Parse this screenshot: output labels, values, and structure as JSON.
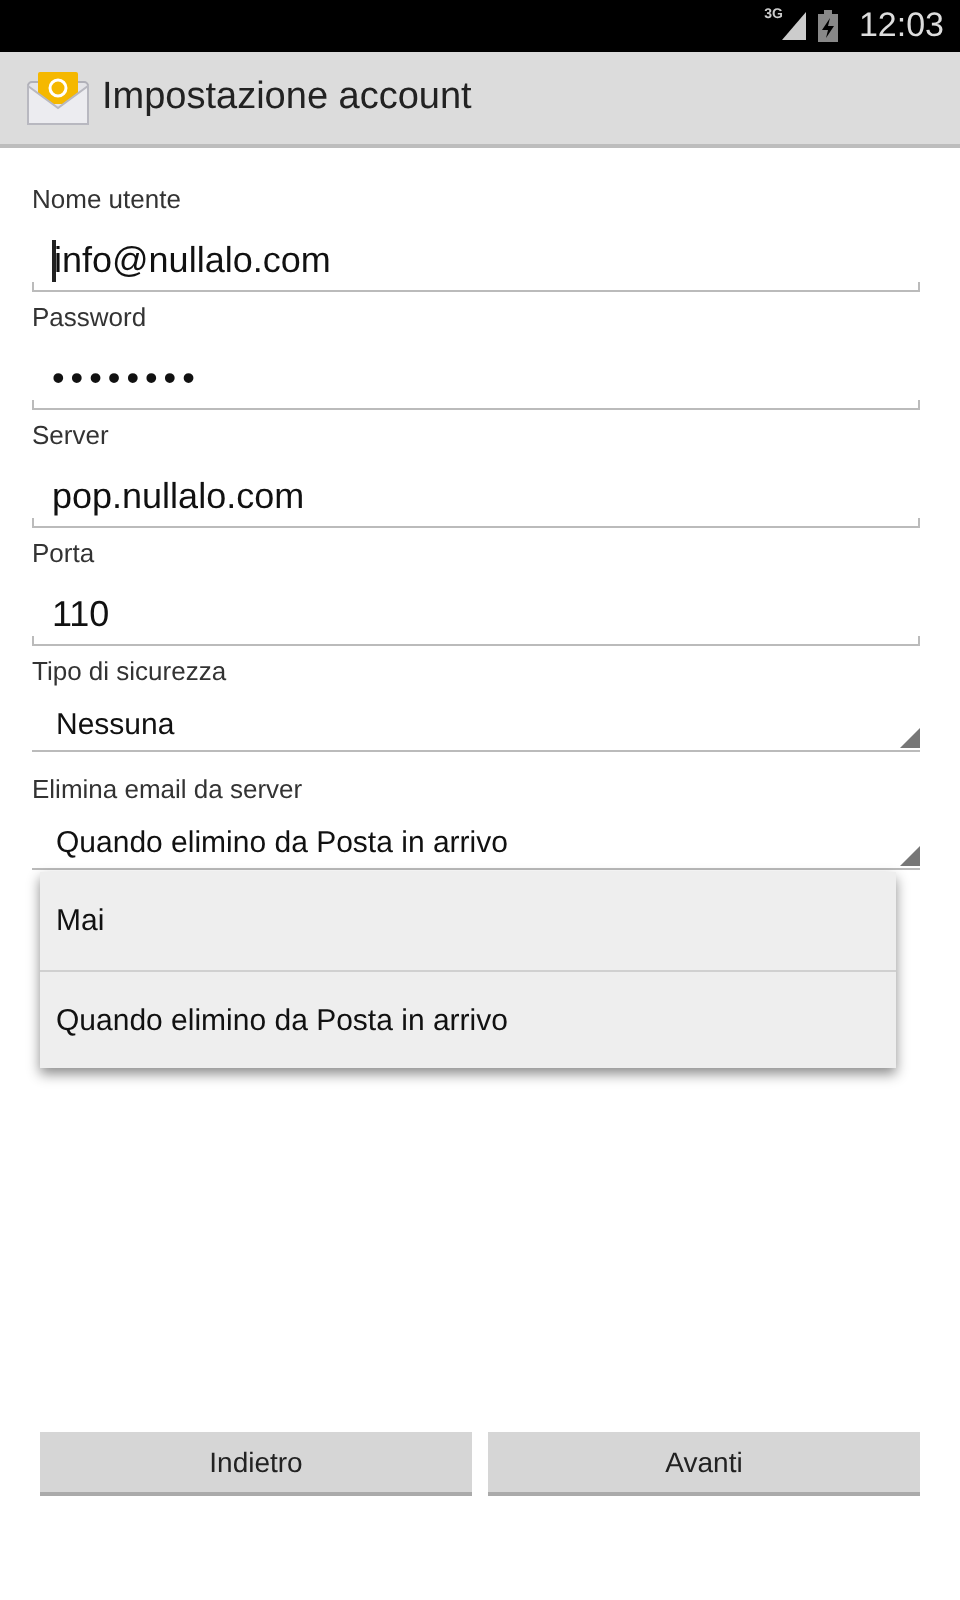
{
  "status_bar": {
    "network": "3G",
    "time": "12:03"
  },
  "action_bar": {
    "title": "Impostazione account"
  },
  "fields": [
    {
      "kind": "text",
      "label": "Nome utente",
      "value": "info@nullalo.com",
      "focused": true
    },
    {
      "kind": "text",
      "label": "Password",
      "value": "••••••••",
      "focused": false
    },
    {
      "kind": "text",
      "label": "Server",
      "value": "pop.nullalo.com",
      "focused": false
    },
    {
      "kind": "text",
      "label": "Porta",
      "value": "110",
      "focused": false
    },
    {
      "kind": "select",
      "label": "Tipo di sicurezza",
      "value": "Nessuna",
      "focused": false
    },
    {
      "kind": "select",
      "label": "Elimina email da server",
      "value": "Quando elimino da Posta in arrivo",
      "focused": false
    }
  ],
  "dropdown": {
    "options": [
      "Mai",
      "Quando elimino da Posta in arrivo"
    ]
  },
  "buttons": [
    "Indietro",
    "Avanti"
  ]
}
